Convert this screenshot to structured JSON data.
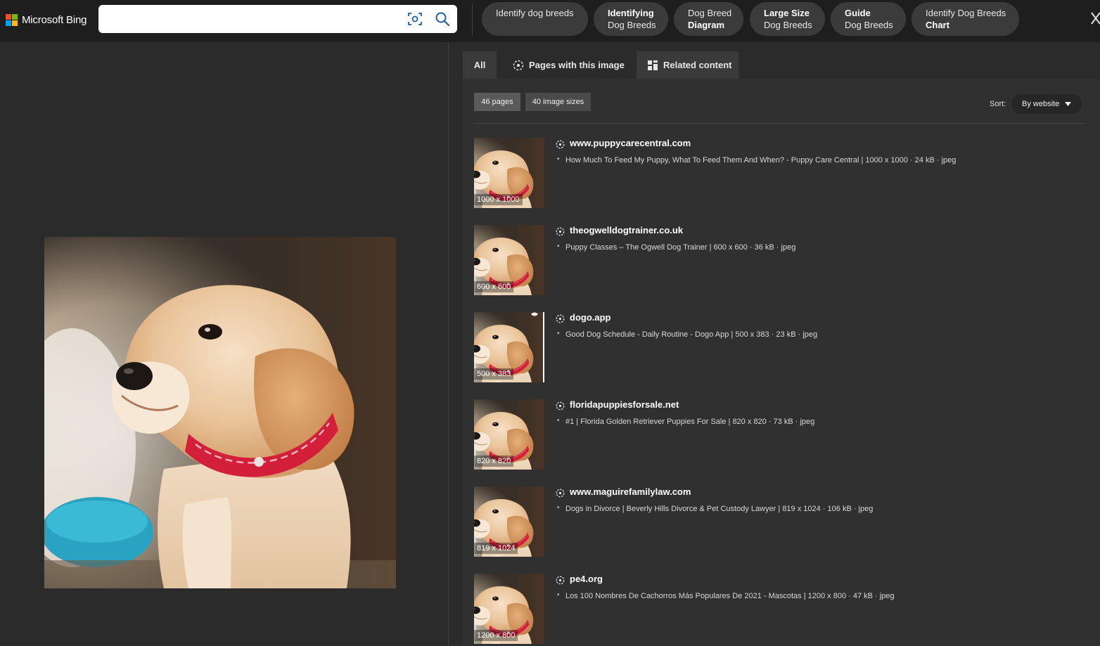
{
  "header": {
    "brand": "Microsoft Bing",
    "search_value": "",
    "search_placeholder": "",
    "chips": [
      {
        "line1": "Identify dog breeds",
        "line1_bold": false,
        "line2": "",
        "line2_bold": false
      },
      {
        "line1": "Identifying",
        "line1_bold": true,
        "line2": "Dog Breeds",
        "line2_bold": false
      },
      {
        "line1": "Dog Breed",
        "line1_bold": false,
        "line2": "Diagram",
        "line2_bold": true
      },
      {
        "line1": "Large Size",
        "line1_bold": true,
        "line2": "Dog Breeds",
        "line2_bold": false
      },
      {
        "line1": "Guide",
        "line1_bold": true,
        "line2": "Dog Breeds",
        "line2_bold": false
      },
      {
        "line1": "Identify Dog Breeds",
        "line1_bold": false,
        "line2": "Chart",
        "line2_bold": true
      }
    ]
  },
  "tabs": [
    {
      "label": "All",
      "icon": "",
      "active": false
    },
    {
      "label": "Pages with this image",
      "icon": "globe-icon",
      "active": true
    },
    {
      "label": "Related content",
      "icon": "grid-icon",
      "active": false
    }
  ],
  "filters": {
    "pages": "46 pages",
    "sizes": "40 image sizes",
    "sort_label": "Sort:",
    "sort_value": "By website"
  },
  "results": [
    {
      "site": "www.puppycarecentral.com",
      "description": "How Much To Feed My Puppy, What To Feed Them And When? - Puppy Care Central | 1000 x 1000 · 24 kB · jpeg",
      "size": "1000 x 1000"
    },
    {
      "site": "theogwelldogtrainer.co.uk",
      "description": "Puppy Classes – The Ogwell Dog Trainer | 600 x 600 · 36 kB · jpeg",
      "size": "600 x 600"
    },
    {
      "site": "dogo.app",
      "description": "Good Dog Schedule - Daily Routine - Dogo App | 500 x 383 · 23 kB · jpeg",
      "size": "500 x 383"
    },
    {
      "site": "floridapuppiesforsale.net",
      "description": "#1 | Florida Golden Retriever Puppies For Sale | 820 x 820 · 73 kB · jpeg",
      "size": "820 x 820"
    },
    {
      "site": "www.maguirefamilylaw.com",
      "description": "Dogs in Divorce | Beverly Hills Divorce & Pet Custody Lawyer | 819 x 1024 · 106 kB · jpeg",
      "size": "819 x 1024"
    },
    {
      "site": "pe4.org",
      "description": "Los 100 Nombres De Cachorros Más Populares De 2021 - Mascotas | 1200 x 800 · 47 kB · jpeg",
      "size": "1200 x 800"
    }
  ],
  "colors": {
    "ms_red": "#f25022",
    "ms_green": "#7fba00",
    "ms_blue": "#00a4ef",
    "ms_yellow": "#ffb900",
    "search_icon": "#1a5fb4"
  }
}
